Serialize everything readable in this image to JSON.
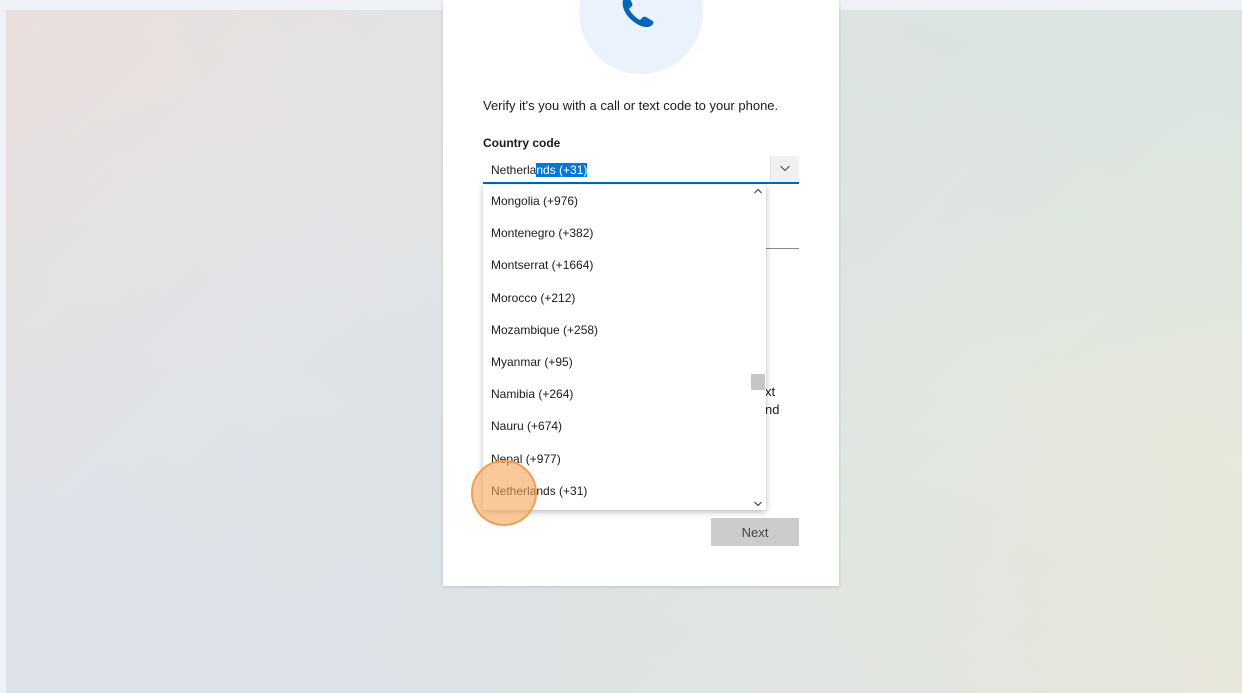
{
  "page": {
    "prompt": "Verify it's you with a call or text code to your phone.",
    "country_code_label": "Country code",
    "selected_prefix": "Netherla",
    "selected_highlight": "nds (+31)",
    "next_label": "Next",
    "partial_text_1": "xt",
    "partial_text_2": "nd"
  },
  "dropdown": {
    "options": [
      "Mongolia (+976)",
      "Montenegro (+382)",
      "Montserrat (+1664)",
      "Morocco (+212)",
      "Mozambique (+258)",
      "Myanmar (+95)",
      "Namibia (+264)",
      "Nauru (+674)",
      "Nepal (+977)",
      "Netherlands (+31)"
    ]
  },
  "colors": {
    "accent": "#0067b8",
    "selection_highlight": "#0078d7",
    "click_marker": "#f0a050"
  },
  "icons": [
    "phone-icon",
    "chevron-down-icon",
    "scroll-up-arrow-icon",
    "scroll-down-arrow-icon"
  ]
}
